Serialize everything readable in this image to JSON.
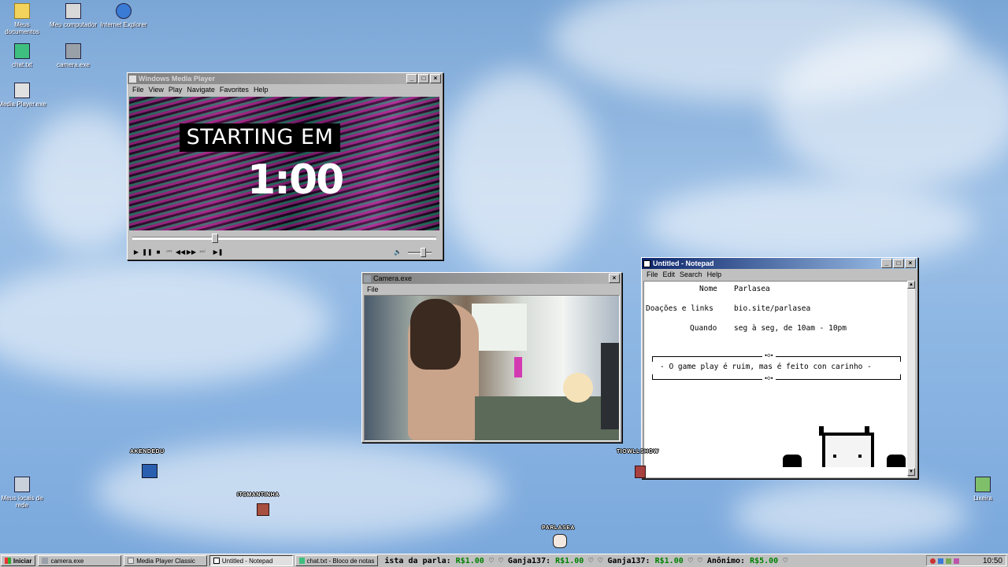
{
  "desktop": {
    "icons": [
      {
        "label": "Meus documentos",
        "name": "folder-icon"
      },
      {
        "label": "Meu computador",
        "name": "computer-icon"
      },
      {
        "label": "Internet Explorer",
        "name": "internet-explorer-icon"
      },
      {
        "label": "chat.txt",
        "name": "text-file-icon"
      },
      {
        "label": "camera.exe",
        "name": "camera-icon"
      },
      {
        "label": "Media Player.exe",
        "name": "media-player-icon"
      },
      {
        "label": "Meus locais de rede",
        "name": "network-icon"
      },
      {
        "label": "Lixeira",
        "name": "recycle-bin-icon"
      }
    ],
    "sprites": [
      {
        "label": "AKENDEDU"
      },
      {
        "label": "ITSMANTINHA"
      },
      {
        "label": "TIOWLLSHOW"
      },
      {
        "label": "PARLASEA"
      }
    ]
  },
  "media_player": {
    "title": "Windows Media Player",
    "menu": [
      "File",
      "View",
      "Play",
      "Navigate",
      "Favorites",
      "Help"
    ],
    "overlay_heading": "STARTING EM",
    "countdown": "1:00",
    "seek_progress": 0.27,
    "volume_level": 0.6
  },
  "camera": {
    "title": "Camera.exe",
    "menu": [
      "File"
    ]
  },
  "notepad": {
    "title": "Untitled - Notepad",
    "menu": [
      "File",
      "Edit",
      "Search",
      "Help"
    ],
    "fields": [
      {
        "label": "Nome",
        "value": "Parlasea"
      },
      {
        "label": "Doações e links",
        "value": "bio.site/parlasea"
      },
      {
        "label": "Quando",
        "value": "seg à seg, de 10am - 10pm"
      }
    ],
    "ornament": "⬩◇⬩",
    "motto": "- O game play é ruim, mas é feito con carinho -"
  },
  "taskbar": {
    "start_label": "Iniciar",
    "tasks": [
      {
        "label": "camera.exe",
        "pressed": false
      },
      {
        "label": "Media Player Classic",
        "pressed": false
      },
      {
        "label": "Untitled - Notepad",
        "pressed": true
      },
      {
        "label": "chat.txt - Bloco de notas",
        "pressed": false
      }
    ],
    "ticker": "ista da parla: R$1.00 ♡   ♡ Ganja137: R$1.00 ♡   ♡ Ganja137: R$1.00 ♡   ♡ Anônimo: R$5.00 ♡",
    "ticker_parts": [
      {
        "name": "ista da parla:",
        "amount": "R$1.00"
      },
      {
        "name": "Ganja137:",
        "amount": "R$1.00"
      },
      {
        "name": "Ganja137:",
        "amount": "R$1.00"
      },
      {
        "name": "Anônimo:",
        "amount": "R$5.00"
      }
    ],
    "clock": "10:50"
  },
  "colors": {
    "active_title": "#0a246a",
    "inactive_title": "#808080",
    "ticker_amount": "#008000"
  }
}
